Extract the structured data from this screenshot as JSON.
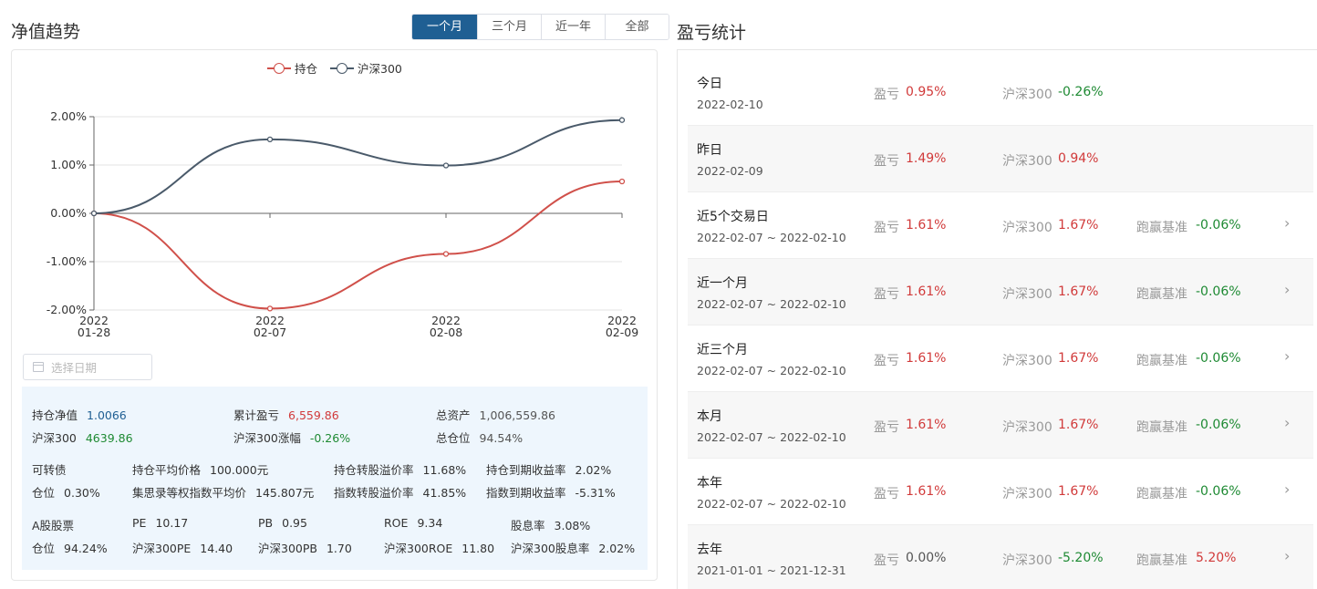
{
  "left": {
    "title": "净值趋势",
    "tabs": [
      "一个月",
      "三个月",
      "近一年",
      "全部"
    ],
    "active_tab": 0,
    "date_placeholder": "选择日期"
  },
  "chart_data": {
    "type": "line",
    "x": [
      "2022\n01-28",
      "2022\n02-07",
      "2022\n02-08",
      "2022\n02-09"
    ],
    "x_tick_labels": [
      [
        "2022",
        "01-28"
      ],
      [
        "2022",
        "02-07"
      ],
      [
        "2022",
        "02-08"
      ],
      [
        "2022",
        "02-09"
      ]
    ],
    "y_tick_labels": [
      "2.00%",
      "1.00%",
      "0.00%",
      "-1.00%",
      "-2.00%"
    ],
    "ylim": [
      -2,
      2
    ],
    "grid": true,
    "legend": "top-center",
    "series": [
      {
        "name": "持仓",
        "color": "#d0504a",
        "values": [
          0.0,
          -1.97,
          -0.84,
          0.66
        ]
      },
      {
        "name": "沪深300",
        "color": "#4a5a6a",
        "values": [
          0.0,
          1.53,
          0.99,
          1.93
        ]
      }
    ]
  },
  "stats": {
    "row1": [
      {
        "label": "持仓净值",
        "value": "1.0066",
        "color": "blue"
      },
      {
        "label": "累计盈亏",
        "value": "6,559.86",
        "color": "red"
      },
      {
        "label": "总资产",
        "value": "1,006,559.86",
        "color": "gray"
      }
    ],
    "row2": [
      {
        "label": "沪深300",
        "value": "4639.86",
        "color": "green"
      },
      {
        "label": "沪深300涨幅",
        "value": "-0.26%",
        "color": "green"
      },
      {
        "label": "总仓位",
        "value": "94.54%",
        "color": "gray"
      }
    ],
    "bond": {
      "title": "可转债",
      "position_label": "仓位",
      "position_value": "0.30%",
      "items": [
        {
          "label": "持仓平均价格",
          "value": "100.000元"
        },
        {
          "label": "持仓转股溢价率",
          "value": "11.68%"
        },
        {
          "label": "持仓到期收益率",
          "value": "2.02%"
        },
        {
          "label": "集思录等权指数平均价",
          "value": "145.807元"
        },
        {
          "label": "指数转股溢价率",
          "value": "41.85%"
        },
        {
          "label": "指数到期收益率",
          "value": "-5.31%"
        }
      ]
    },
    "stock": {
      "title": "A股股票",
      "position_label": "仓位",
      "position_value": "94.24%",
      "items": [
        {
          "label": "PE",
          "value": "10.17"
        },
        {
          "label": "PB",
          "value": "0.95"
        },
        {
          "label": "ROE",
          "value": "9.34"
        },
        {
          "label": "股息率",
          "value": "3.08%"
        },
        {
          "label": "沪深300PE",
          "value": "14.40"
        },
        {
          "label": "沪深300PB",
          "value": "1.70"
        },
        {
          "label": "沪深300ROE",
          "value": "11.80"
        },
        {
          "label": "沪深300股息率",
          "value": "2.02%"
        }
      ]
    }
  },
  "right": {
    "title": "盈亏统计",
    "pl_label": "盈亏",
    "hs_label": "沪深300",
    "bm_label": "跑赢基准",
    "rows": [
      {
        "name": "今日",
        "date": "2022-02-10",
        "pl": "0.95%",
        "pl_color": "red",
        "hs": "-0.26%",
        "hs_color": "green",
        "bm": "",
        "bm_color": "",
        "arrow": false
      },
      {
        "name": "昨日",
        "date": "2022-02-09",
        "pl": "1.49%",
        "pl_color": "red",
        "hs": "0.94%",
        "hs_color": "red",
        "bm": "",
        "bm_color": "",
        "arrow": false
      },
      {
        "name": "近5个交易日",
        "date": "2022-02-07 ~ 2022-02-10",
        "pl": "1.61%",
        "pl_color": "red",
        "hs": "1.67%",
        "hs_color": "red",
        "bm": "-0.06%",
        "bm_color": "green",
        "arrow": true
      },
      {
        "name": "近一个月",
        "date": "2022-02-07 ~ 2022-02-10",
        "pl": "1.61%",
        "pl_color": "red",
        "hs": "1.67%",
        "hs_color": "red",
        "bm": "-0.06%",
        "bm_color": "green",
        "arrow": true
      },
      {
        "name": "近三个月",
        "date": "2022-02-07 ~ 2022-02-10",
        "pl": "1.61%",
        "pl_color": "red",
        "hs": "1.67%",
        "hs_color": "red",
        "bm": "-0.06%",
        "bm_color": "green",
        "arrow": true
      },
      {
        "name": "本月",
        "date": "2022-02-07 ~ 2022-02-10",
        "pl": "1.61%",
        "pl_color": "red",
        "hs": "1.67%",
        "hs_color": "red",
        "bm": "-0.06%",
        "bm_color": "green",
        "arrow": true
      },
      {
        "name": "本年",
        "date": "2022-02-07 ~ 2022-02-10",
        "pl": "1.61%",
        "pl_color": "red",
        "hs": "1.67%",
        "hs_color": "red",
        "bm": "-0.06%",
        "bm_color": "green",
        "arrow": true
      },
      {
        "name": "去年",
        "date": "2021-01-01 ~ 2021-12-31",
        "pl": "0.00%",
        "pl_color": "gray",
        "hs": "-5.20%",
        "hs_color": "green",
        "bm": "5.20%",
        "bm_color": "red",
        "arrow": true
      }
    ]
  }
}
